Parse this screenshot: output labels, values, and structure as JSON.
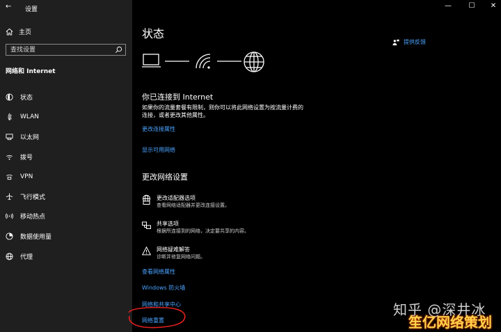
{
  "window": {
    "title": "设置",
    "back_glyph": "←",
    "minimize_glyph": "—",
    "maximize_glyph": "☐",
    "close_glyph": "✕"
  },
  "sidebar": {
    "home_label": "主页",
    "search_placeholder": "查找设置",
    "section_title": "网络和 Internet",
    "items": [
      {
        "label": "状态",
        "icon": "globe-icon"
      },
      {
        "label": "WLAN",
        "icon": "wifi-icon"
      },
      {
        "label": "以太网",
        "icon": "ethernet-icon"
      },
      {
        "label": "拨号",
        "icon": "dialup-icon"
      },
      {
        "label": "VPN",
        "icon": "vpn-icon"
      },
      {
        "label": "飞行模式",
        "icon": "airplane-icon"
      },
      {
        "label": "移动热点",
        "icon": "hotspot-icon"
      },
      {
        "label": "数据使用量",
        "icon": "data-usage-icon"
      },
      {
        "label": "代理",
        "icon": "proxy-icon"
      }
    ]
  },
  "main": {
    "page_title": "状态",
    "feedback_label": "提供反馈",
    "connected": {
      "heading": "你已连接到 Internet",
      "desc_line1": "如果你的流量套餐有限制，则你可以将此网络设置为按流量计费的",
      "desc_line2": "连接，或者更改其他属性。",
      "link_change_props": "更改连接属性",
      "link_show_networks": "显示可用网络"
    },
    "change_settings": {
      "heading": "更改网络设置",
      "options": [
        {
          "title": "更改适配器选项",
          "desc": "查看网络适配器并更改连接设置。",
          "icon": "adapter-icon"
        },
        {
          "title": "共享选项",
          "desc": "根据所连接到的网络，决定要共享的内容。",
          "icon": "sharing-icon"
        },
        {
          "title": "网络疑难解答",
          "desc": "诊断并修复网络问题。",
          "icon": "warning-icon"
        }
      ],
      "link_view_props": "查看网络属性",
      "link_firewall": "Windows 防火墙",
      "link_sharing_center": "网络和共享中心",
      "link_reset": "网络重置"
    },
    "annotation_color": "#e02020"
  },
  "watermark": {
    "site": "知乎 @深井冰",
    "brand": "笙亿网络策划"
  },
  "colors": {
    "sidebar_bg": "#1f1f1f",
    "main_bg": "#000000",
    "link": "#4aa3ff"
  }
}
